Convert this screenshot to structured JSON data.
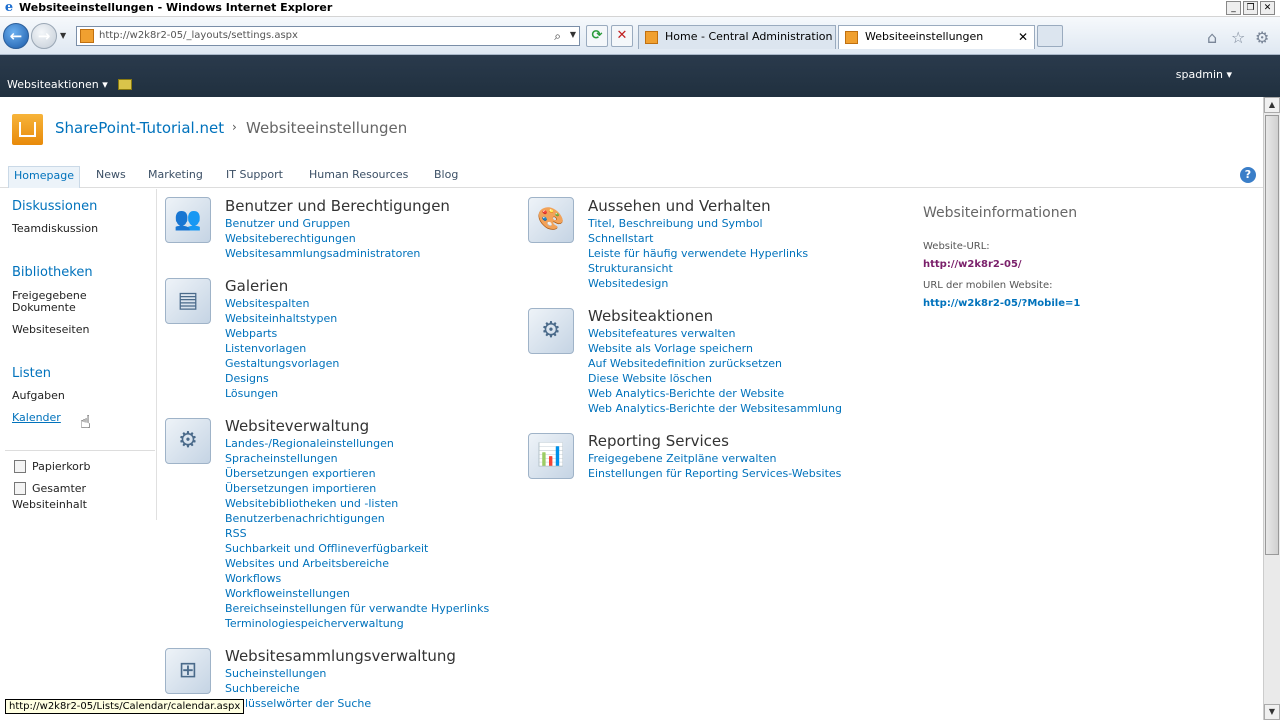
{
  "window": {
    "title": "Websiteeinstellungen - Windows Internet Explorer",
    "minimize": "_",
    "restore": "❐",
    "close": "✕"
  },
  "browser": {
    "url": "http://w2k8r2-05/_layouts/settings.aspx",
    "tabs": [
      {
        "label": "Home - Central Administration"
      },
      {
        "label": "Websiteeinstellungen",
        "close": "✕"
      }
    ]
  },
  "ribbon": {
    "site_actions": "Websiteaktionen ▾",
    "user": "spadmin ▾"
  },
  "header": {
    "site_title": "SharePoint-Tutorial.net",
    "separator": "›",
    "page_title": "Websiteeinstellungen"
  },
  "topnav": [
    "Homepage",
    "News",
    "Marketing",
    "IT Support",
    "Human Resources",
    "Blog"
  ],
  "quicklaunch": {
    "discussions": {
      "heading": "Diskussionen",
      "items": [
        "Teamdiskussion"
      ]
    },
    "libraries": {
      "heading": "Bibliotheken",
      "items": [
        "Freigegebene",
        "Dokumente",
        "Websiteseiten"
      ]
    },
    "lists": {
      "heading": "Listen",
      "items": [
        "Aufgaben",
        "Kalender"
      ]
    },
    "recycle_bin": "Papierkorb",
    "all_content_1": "Gesamter",
    "all_content_2": "Websiteinhalt"
  },
  "sections": {
    "users": {
      "title": "Benutzer und Berechtigungen",
      "links": [
        "Benutzer und Gruppen",
        "Websiteberechtigungen",
        "Websitesammlungsadministratoren"
      ]
    },
    "galleries": {
      "title": "Galerien",
      "links": [
        "Websitespalten",
        "Websiteinhaltstypen",
        "Webparts",
        "Listenvorlagen",
        "Gestaltungsvorlagen",
        "Designs",
        "Lösungen"
      ]
    },
    "admin": {
      "title": "Websiteverwaltung",
      "links": [
        "Landes-/Regionaleinstellungen",
        "Spracheinstellungen",
        "Übersetzungen exportieren",
        "Übersetzungen importieren",
        "Websitebibliotheken und -listen",
        "Benutzerbenachrichtigungen",
        "RSS",
        "Suchbarkeit und Offlineverfügbarkeit",
        "Websites und Arbeitsbereiche",
        "Workflows",
        "Workfloweinstellungen",
        "Bereichseinstellungen für verwandte Hyperlinks",
        "Terminologiespeicherverwaltung"
      ]
    },
    "collection": {
      "title": "Websitesammlungsverwaltung",
      "links": [
        "Sucheinstellungen",
        "Suchbereiche",
        "Schlüsselwörter der Suche"
      ]
    },
    "look": {
      "title": "Aussehen und Verhalten",
      "links": [
        "Titel, Beschreibung und Symbol",
        "Schnellstart",
        "Leiste für häufig verwendete Hyperlinks",
        "Strukturansicht",
        "Websitedesign"
      ]
    },
    "actions": {
      "title": "Websiteaktionen",
      "links": [
        "Websitefeatures verwalten",
        "Website als Vorlage speichern",
        "Auf Websitedefinition zurücksetzen",
        "Diese Website löschen",
        "Web Analytics-Berichte der Website",
        "Web Analytics-Berichte der Websitesammlung"
      ]
    },
    "reporting": {
      "title": "Reporting Services",
      "links": [
        "Freigegebene Zeitpläne verwalten",
        "Einstellungen für Reporting Services-Websites"
      ]
    }
  },
  "site_info": {
    "title": "Websiteinformationen",
    "url_label": "Website-URL:",
    "url": "http://w2k8r2-05/",
    "mobile_label": "URL der mobilen Website:",
    "mobile_url": "http://w2k8r2-05/?Mobile=1"
  },
  "status_bar": "http://w2k8r2-05/Lists/Calendar/calendar.aspx"
}
